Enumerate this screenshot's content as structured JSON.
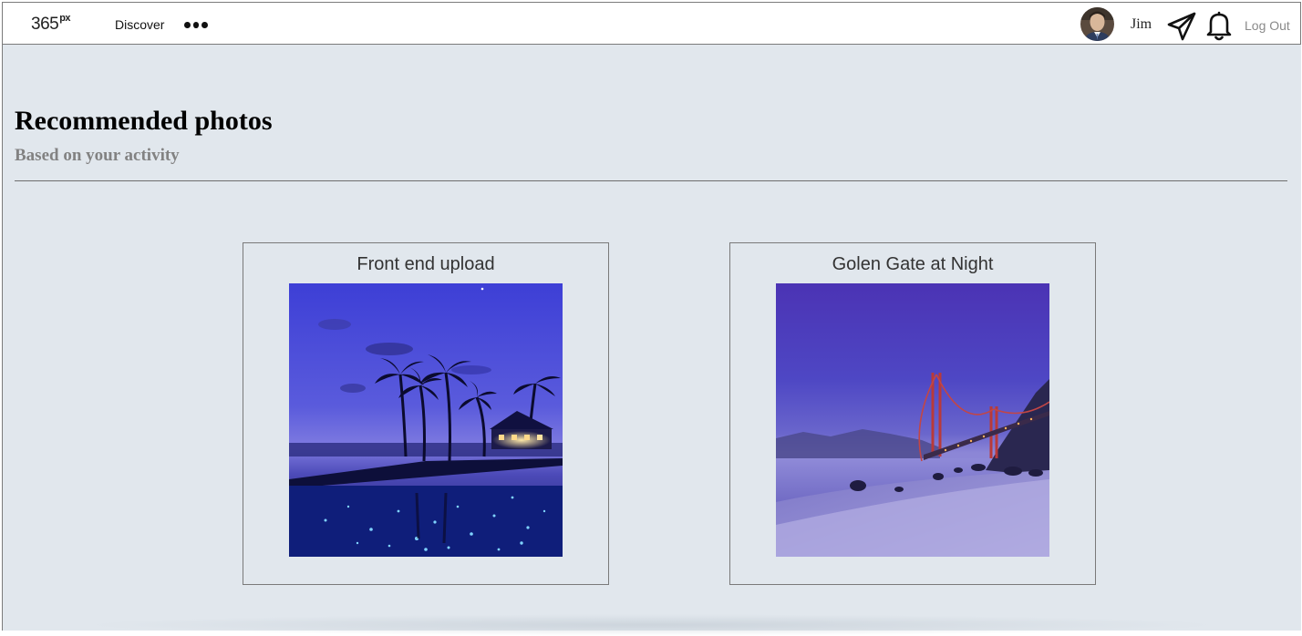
{
  "navbar": {
    "logo_text": "365",
    "logo_sup": "px",
    "discover_label": "Discover",
    "more_icon": "more-dots-icon",
    "user_name": "Jim",
    "send_icon": "paper-plane-icon",
    "notifications_icon": "bell-icon",
    "logout_label": "Log Out"
  },
  "header": {
    "title": "Recommended photos",
    "subtitle": "Based on your activity"
  },
  "photos": [
    {
      "title": "Front end upload"
    },
    {
      "title": "Golen Gate at Night"
    }
  ],
  "colors": {
    "page_background": "#e1e7ed",
    "navbar_background": "#ffffff",
    "subtitle_text": "#828282",
    "logout_text": "#8a8a8a"
  }
}
